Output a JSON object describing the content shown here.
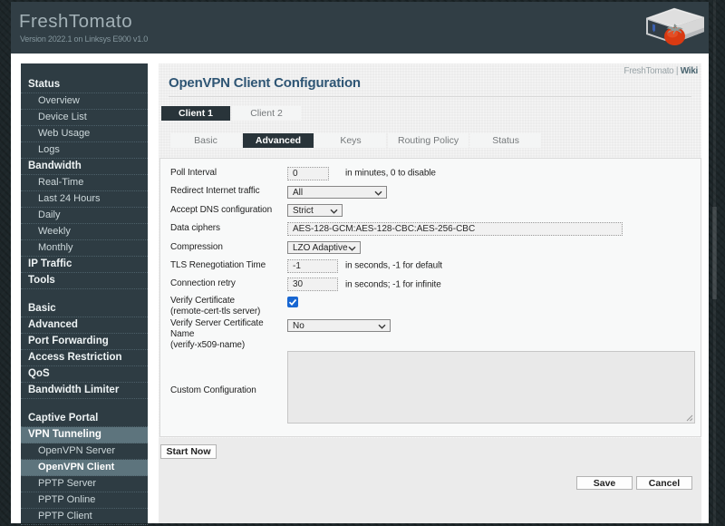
{
  "header": {
    "logo": "FreshTomato",
    "version": "Version 2022.1 on Linksys E900 v1.0",
    "router_icon": "router-with-tomato-icon"
  },
  "breadcrumb": {
    "site": "FreshTomato",
    "separator": " | ",
    "wiki_link": "Wiki"
  },
  "page": {
    "title": "OpenVPN Client Configuration"
  },
  "sidebar": {
    "items": [
      {
        "label": "Status",
        "type": "section"
      },
      {
        "label": "Overview",
        "type": "sub"
      },
      {
        "label": "Device List",
        "type": "sub"
      },
      {
        "label": "Web Usage",
        "type": "sub"
      },
      {
        "label": "Logs",
        "type": "sub"
      },
      {
        "label": "Bandwidth",
        "type": "section"
      },
      {
        "label": "Real-Time",
        "type": "sub"
      },
      {
        "label": "Last 24 Hours",
        "type": "sub"
      },
      {
        "label": "Daily",
        "type": "sub"
      },
      {
        "label": "Weekly",
        "type": "sub"
      },
      {
        "label": "Monthly",
        "type": "sub"
      },
      {
        "label": "IP Traffic",
        "type": "section"
      },
      {
        "label": "Tools",
        "type": "section"
      },
      {
        "label": "",
        "type": "spacer"
      },
      {
        "label": "Basic",
        "type": "section"
      },
      {
        "label": "Advanced",
        "type": "section"
      },
      {
        "label": "Port Forwarding",
        "type": "section"
      },
      {
        "label": "Access Restriction",
        "type": "section"
      },
      {
        "label": "QoS",
        "type": "section"
      },
      {
        "label": "Bandwidth Limiter",
        "type": "section"
      },
      {
        "label": "",
        "type": "spacer"
      },
      {
        "label": "Captive Portal",
        "type": "section"
      },
      {
        "label": "VPN Tunneling",
        "type": "section",
        "highlighted": true
      },
      {
        "label": "OpenVPN Server",
        "type": "sub"
      },
      {
        "label": "OpenVPN Client",
        "type": "sub",
        "highlighted": true,
        "current": true
      },
      {
        "label": "PPTP Server",
        "type": "sub"
      },
      {
        "label": "PPTP Online",
        "type": "sub"
      },
      {
        "label": "PPTP Client",
        "type": "sub"
      }
    ]
  },
  "tabs": {
    "clients": [
      {
        "label": "Client 1",
        "active": true
      },
      {
        "label": "Client 2",
        "active": false
      }
    ],
    "sections": [
      {
        "label": "Basic",
        "active": false
      },
      {
        "label": "Advanced",
        "active": true
      },
      {
        "label": "Keys",
        "active": false
      },
      {
        "label": "Routing Policy",
        "active": false
      },
      {
        "label": "Status",
        "active": false
      }
    ]
  },
  "form": {
    "rows": [
      {
        "label": [
          "Poll Interval"
        ],
        "control": "input",
        "value": "0",
        "note": "in minutes, 0 to disable"
      },
      {
        "label": [
          "Redirect Internet traffic"
        ],
        "control": "select",
        "value": "All"
      },
      {
        "label": [
          "Accept DNS configuration"
        ],
        "control": "select",
        "value": "Strict"
      },
      {
        "label": [
          "Data ciphers"
        ],
        "control": "input-wide",
        "value": "AES-128-GCM:AES-128-CBC:AES-256-CBC"
      },
      {
        "label": [
          "Compression"
        ],
        "control": "select",
        "value": "LZO Adaptive"
      },
      {
        "label": [
          "TLS Renegotiation Time"
        ],
        "control": "input",
        "value": "-1",
        "note": "in seconds, -1 for default"
      },
      {
        "label": [
          "Connection retry"
        ],
        "control": "input",
        "value": "30",
        "note": "in seconds; -1 for infinite"
      },
      {
        "label": [
          "Verify Certificate",
          "(remote-cert-tls server)"
        ],
        "control": "checkbox",
        "checked": true
      },
      {
        "label": [
          "Verify Server Certificate",
          "Name",
          "(verify-x509-name)"
        ],
        "control": "select",
        "value": "No"
      },
      {
        "label": [
          "Custom Configuration"
        ],
        "control": "textarea",
        "value": ""
      }
    ]
  },
  "buttons": {
    "start_now": "Start Now",
    "save": "Save",
    "cancel": "Cancel"
  },
  "colors": {
    "header_bg": "#313e45",
    "sidebar_bg": "#2e3c43",
    "sidebar_highlight": "#5d747d",
    "active_tab_bg": "#29343a",
    "title_color": "#2e5574",
    "checkbox_blue": "#1867d2",
    "tomato_red": "#d93a12"
  }
}
